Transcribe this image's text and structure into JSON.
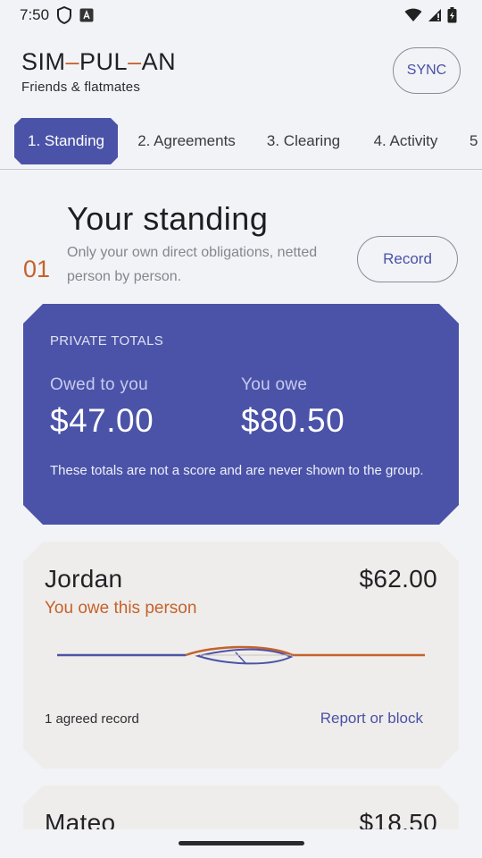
{
  "status_bar": {
    "time": "7:50"
  },
  "header": {
    "brand_parts": [
      "SIM",
      "PUL",
      "AN"
    ],
    "subtitle": "Friends & flatmates",
    "sync_label": "SYNC"
  },
  "tabs": [
    {
      "label": "1. Standing",
      "active": true
    },
    {
      "label": "2. Agreements",
      "active": false
    },
    {
      "label": "3. Clearing",
      "active": false
    },
    {
      "label": "4. Activity",
      "active": false
    },
    {
      "label": "5",
      "active": false
    }
  ],
  "section": {
    "number": "01",
    "title": "Your standing",
    "description": "Only your own direct obligations, netted person by person.",
    "record_label": "Record"
  },
  "totals": {
    "label": "PRIVATE TOTALS",
    "owed_caption": "Owed to you",
    "owed_value": "$47.00",
    "owe_caption": "You owe",
    "owe_value": "$80.50",
    "note": "These totals are not a score and are never shown to the group."
  },
  "people": [
    {
      "name": "Jordan",
      "amount": "$62.00",
      "status": "You owe this person",
      "records": "1 agreed record",
      "report_label": "Report or block"
    },
    {
      "name": "Mateo",
      "amount": "$18.50"
    }
  ],
  "colors": {
    "accent": "#4b53a8",
    "warm": "#c4622d",
    "background": "#f2f3f6",
    "card": "#efedeb"
  }
}
